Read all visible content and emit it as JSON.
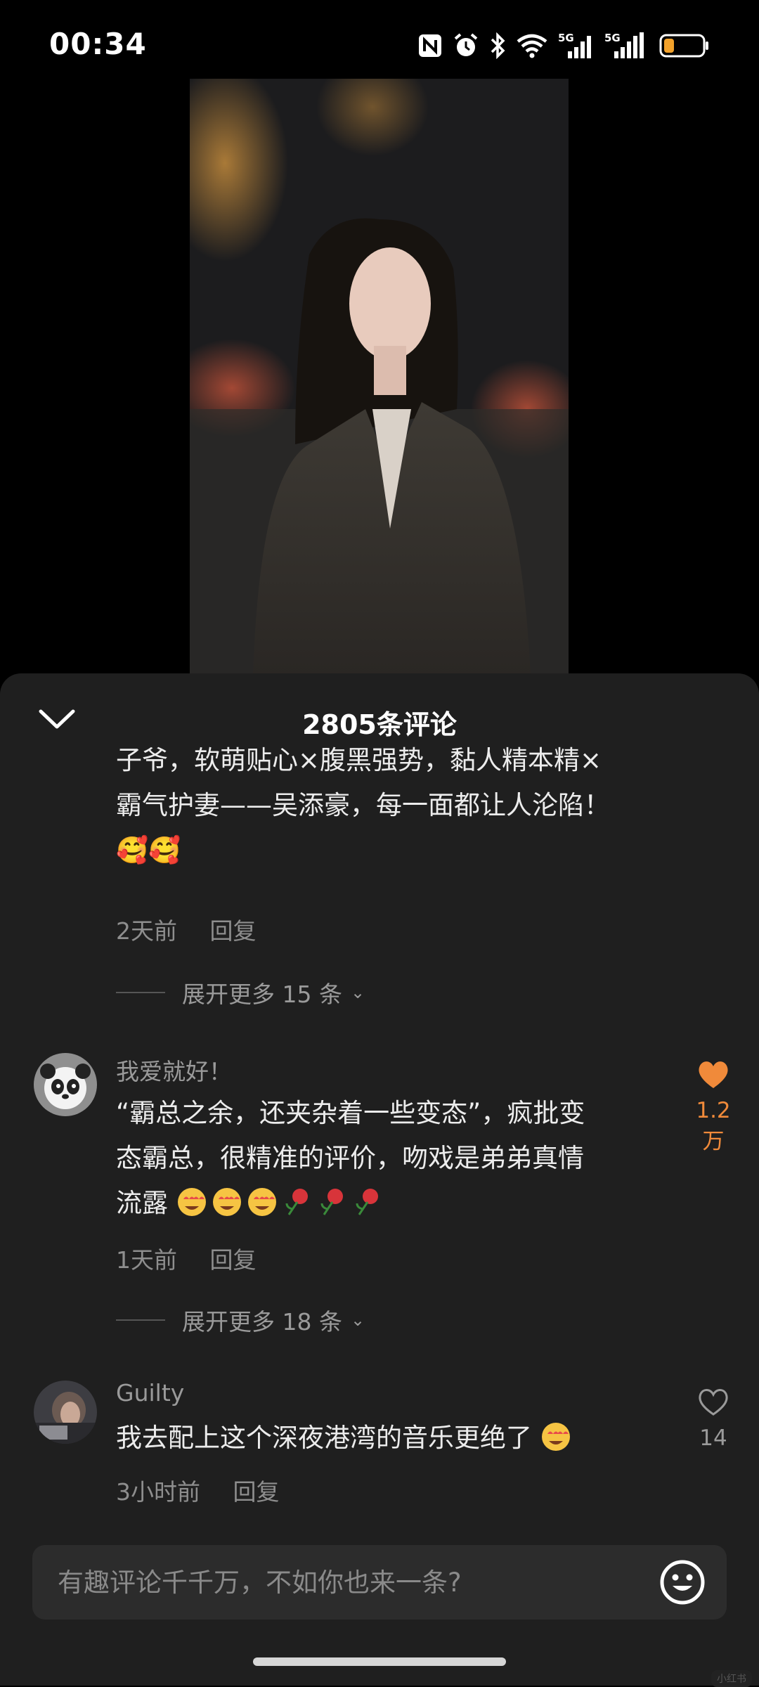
{
  "status_bar": {
    "time": "00:34"
  },
  "sheet": {
    "title": "2805条评论",
    "comments": [
      {
        "text_line1": "子爷，软萌贴心×腹黑强势，黏人精本精×",
        "text_line2": "霸气护妻——吴添豪，每一面都让人沦陷！",
        "emoji_line": "🥰🥰",
        "time": "2天前",
        "reply": "回复",
        "expand": "展开更多 15 条"
      },
      {
        "username": "我爱就好！",
        "text_line1": "“霸总之余，还夹杂着一些变态”，疯批变",
        "text_line2": "态霸总，很精准的评价，吻戏是弟弟真情",
        "text_line3": "流露",
        "time": "1天前",
        "reply": "回复",
        "likes": "1.2万",
        "like_color": "#f08a3a",
        "expand": "展开更多 18 条"
      },
      {
        "username": "Guilty",
        "text": "我去配上这个深夜港湾的音乐更绝了",
        "time": "3小时前",
        "reply": "回复",
        "likes": "14"
      }
    ]
  },
  "input": {
    "placeholder": "有趣评论千千万，不如你也来一条?"
  },
  "corner_badge": "小红书"
}
